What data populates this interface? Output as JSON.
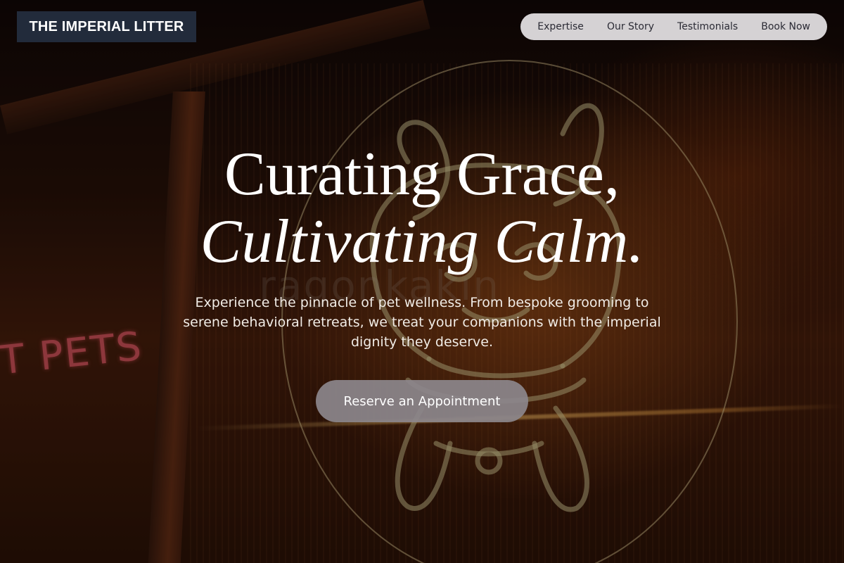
{
  "brand": {
    "logo_text": "THE IMPERIAL LITTER"
  },
  "nav": {
    "items": [
      {
        "label": "Expertise"
      },
      {
        "label": "Our Story"
      },
      {
        "label": "Testimonials"
      },
      {
        "label": "Book Now"
      }
    ]
  },
  "hero": {
    "headline_line1": "Curating Grace,",
    "headline_line2": "Cultivating Calm.",
    "subtext": "Experience the pinnacle of pet wellness. From bespoke grooming to serene behavioral retreats, we treat your companions with the imperial dignity they deserve.",
    "cta_label": "Reserve an Appointment",
    "background_sign_text": "T PETS"
  },
  "colors": {
    "logo_bg": "#222b3b",
    "nav_bg": "#e6e4e6",
    "cta_bg": "#8c878c",
    "neon_sign": "#d9555d",
    "neon_line": "#e6cd96"
  }
}
